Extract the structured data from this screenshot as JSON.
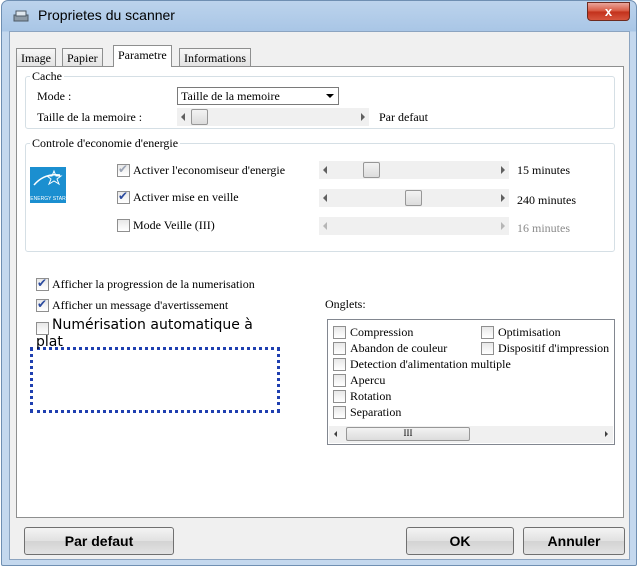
{
  "window": {
    "title": "Proprietes du scanner",
    "close_label": "x"
  },
  "tabs": [
    "Image",
    "Papier",
    "Parametre",
    "Informations"
  ],
  "cache": {
    "legend": "Cache",
    "mode_label": "Mode :",
    "mode_value": "Taille de la memoire",
    "memory_label": "Taille de la memoire :",
    "memory_default_label": "Par defaut"
  },
  "energy": {
    "legend": "Controle d'economie d'energie",
    "logo_text": "ENERGY STAR",
    "rows": [
      {
        "label": "Activer l'economiseur d'energie",
        "checked": true,
        "disabled": true,
        "value": "15 minutes"
      },
      {
        "label": "Activer mise en veille",
        "checked": true,
        "disabled": false,
        "value": "240 minutes"
      },
      {
        "label": "Mode Veille (III)",
        "checked": false,
        "disabled": false,
        "value": "16 minutes"
      }
    ]
  },
  "options": [
    {
      "label": "Afficher la progression de la numerisation",
      "checked": true
    },
    {
      "label": "Afficher un message d'avertissement",
      "checked": true
    }
  ],
  "auto_flat": {
    "label_line1": "Numérisation automatique à",
    "label_line2": "plat",
    "checked": false
  },
  "onglets": {
    "label": "Onglets:",
    "items": [
      {
        "label": "Compression",
        "checked": false
      },
      {
        "label": "Optimisation",
        "checked": false
      },
      {
        "label": "Abandon de couleur",
        "checked": false
      },
      {
        "label": "Dispositif d'impression",
        "checked": false
      },
      {
        "label": "Detection d'alimentation multiple",
        "checked": false
      },
      {
        "label": "Apercu",
        "checked": false
      },
      {
        "label": "Rotation",
        "checked": false
      },
      {
        "label": "Separation",
        "checked": false
      }
    ],
    "scroll_thumb": "III"
  },
  "buttons": {
    "default": "Par defaut",
    "ok": "OK",
    "cancel": "Annuler"
  }
}
